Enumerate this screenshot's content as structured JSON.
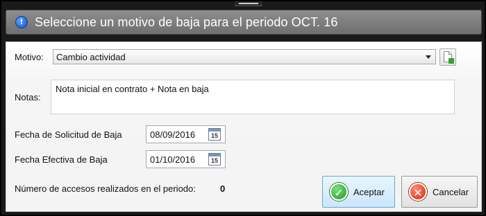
{
  "window": {
    "title": "Seleccione un motivo de baja para el periodo OCT. 16"
  },
  "form": {
    "motivo_label": "Motivo:",
    "motivo_value": "Cambio actividad",
    "notas_label": "Notas:",
    "notas_value": "Nota inicial en contrato + Nota en baja",
    "fecha_solicitud_label": "Fecha de Solicitud de Baja",
    "fecha_solicitud_value": "08/09/2016",
    "fecha_efectiva_label": "Fecha Efectiva de Baja",
    "fecha_efectiva_value": "01/10/2016",
    "calendar_icon_text": "15",
    "accesos_label": "Número de accesos realizados en el periodo:",
    "accesos_value": "0"
  },
  "buttons": {
    "accept_label": "Aceptar",
    "cancel_label": "Cancelar"
  },
  "icons": {
    "title": "info-icon",
    "doc": "add-document-icon",
    "calendar": "calendar-icon",
    "accept": "check-icon",
    "cancel": "close-icon"
  },
  "colors": {
    "titlebar": "#7f7f7f",
    "accept_bg": "#c9e6fb",
    "accept_icon": "#1d9a1d",
    "cancel_icon": "#d22b12"
  }
}
